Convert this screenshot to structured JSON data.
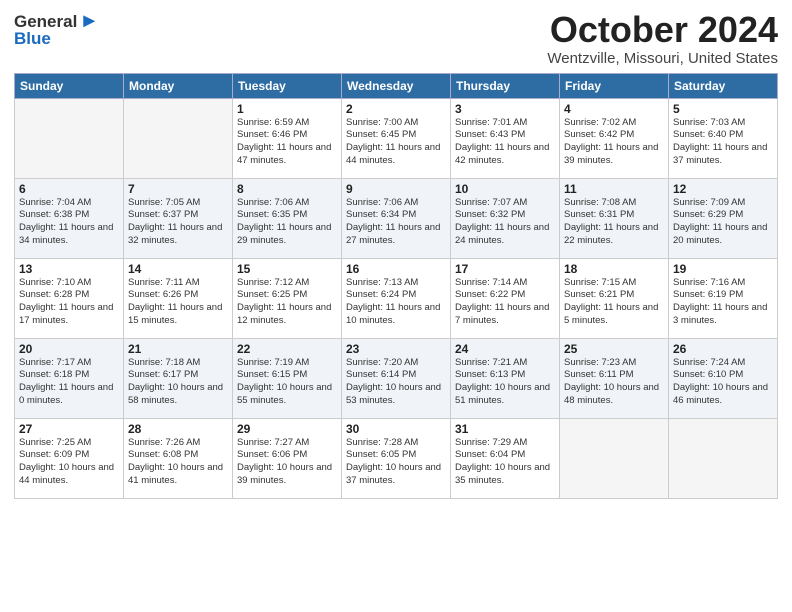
{
  "logo": {
    "general": "General",
    "blue": "Blue"
  },
  "title": {
    "month": "October 2024",
    "location": "Wentzville, Missouri, United States"
  },
  "headers": [
    "Sunday",
    "Monday",
    "Tuesday",
    "Wednesday",
    "Thursday",
    "Friday",
    "Saturday"
  ],
  "weeks": [
    [
      {
        "day": "",
        "info": ""
      },
      {
        "day": "",
        "info": ""
      },
      {
        "day": "1",
        "info": "Sunrise: 6:59 AM\nSunset: 6:46 PM\nDaylight: 11 hours and 47 minutes."
      },
      {
        "day": "2",
        "info": "Sunrise: 7:00 AM\nSunset: 6:45 PM\nDaylight: 11 hours and 44 minutes."
      },
      {
        "day": "3",
        "info": "Sunrise: 7:01 AM\nSunset: 6:43 PM\nDaylight: 11 hours and 42 minutes."
      },
      {
        "day": "4",
        "info": "Sunrise: 7:02 AM\nSunset: 6:42 PM\nDaylight: 11 hours and 39 minutes."
      },
      {
        "day": "5",
        "info": "Sunrise: 7:03 AM\nSunset: 6:40 PM\nDaylight: 11 hours and 37 minutes."
      }
    ],
    [
      {
        "day": "6",
        "info": "Sunrise: 7:04 AM\nSunset: 6:38 PM\nDaylight: 11 hours and 34 minutes."
      },
      {
        "day": "7",
        "info": "Sunrise: 7:05 AM\nSunset: 6:37 PM\nDaylight: 11 hours and 32 minutes."
      },
      {
        "day": "8",
        "info": "Sunrise: 7:06 AM\nSunset: 6:35 PM\nDaylight: 11 hours and 29 minutes."
      },
      {
        "day": "9",
        "info": "Sunrise: 7:06 AM\nSunset: 6:34 PM\nDaylight: 11 hours and 27 minutes."
      },
      {
        "day": "10",
        "info": "Sunrise: 7:07 AM\nSunset: 6:32 PM\nDaylight: 11 hours and 24 minutes."
      },
      {
        "day": "11",
        "info": "Sunrise: 7:08 AM\nSunset: 6:31 PM\nDaylight: 11 hours and 22 minutes."
      },
      {
        "day": "12",
        "info": "Sunrise: 7:09 AM\nSunset: 6:29 PM\nDaylight: 11 hours and 20 minutes."
      }
    ],
    [
      {
        "day": "13",
        "info": "Sunrise: 7:10 AM\nSunset: 6:28 PM\nDaylight: 11 hours and 17 minutes."
      },
      {
        "day": "14",
        "info": "Sunrise: 7:11 AM\nSunset: 6:26 PM\nDaylight: 11 hours and 15 minutes."
      },
      {
        "day": "15",
        "info": "Sunrise: 7:12 AM\nSunset: 6:25 PM\nDaylight: 11 hours and 12 minutes."
      },
      {
        "day": "16",
        "info": "Sunrise: 7:13 AM\nSunset: 6:24 PM\nDaylight: 11 hours and 10 minutes."
      },
      {
        "day": "17",
        "info": "Sunrise: 7:14 AM\nSunset: 6:22 PM\nDaylight: 11 hours and 7 minutes."
      },
      {
        "day": "18",
        "info": "Sunrise: 7:15 AM\nSunset: 6:21 PM\nDaylight: 11 hours and 5 minutes."
      },
      {
        "day": "19",
        "info": "Sunrise: 7:16 AM\nSunset: 6:19 PM\nDaylight: 11 hours and 3 minutes."
      }
    ],
    [
      {
        "day": "20",
        "info": "Sunrise: 7:17 AM\nSunset: 6:18 PM\nDaylight: 11 hours and 0 minutes."
      },
      {
        "day": "21",
        "info": "Sunrise: 7:18 AM\nSunset: 6:17 PM\nDaylight: 10 hours and 58 minutes."
      },
      {
        "day": "22",
        "info": "Sunrise: 7:19 AM\nSunset: 6:15 PM\nDaylight: 10 hours and 55 minutes."
      },
      {
        "day": "23",
        "info": "Sunrise: 7:20 AM\nSunset: 6:14 PM\nDaylight: 10 hours and 53 minutes."
      },
      {
        "day": "24",
        "info": "Sunrise: 7:21 AM\nSunset: 6:13 PM\nDaylight: 10 hours and 51 minutes."
      },
      {
        "day": "25",
        "info": "Sunrise: 7:23 AM\nSunset: 6:11 PM\nDaylight: 10 hours and 48 minutes."
      },
      {
        "day": "26",
        "info": "Sunrise: 7:24 AM\nSunset: 6:10 PM\nDaylight: 10 hours and 46 minutes."
      }
    ],
    [
      {
        "day": "27",
        "info": "Sunrise: 7:25 AM\nSunset: 6:09 PM\nDaylight: 10 hours and 44 minutes."
      },
      {
        "day": "28",
        "info": "Sunrise: 7:26 AM\nSunset: 6:08 PM\nDaylight: 10 hours and 41 minutes."
      },
      {
        "day": "29",
        "info": "Sunrise: 7:27 AM\nSunset: 6:06 PM\nDaylight: 10 hours and 39 minutes."
      },
      {
        "day": "30",
        "info": "Sunrise: 7:28 AM\nSunset: 6:05 PM\nDaylight: 10 hours and 37 minutes."
      },
      {
        "day": "31",
        "info": "Sunrise: 7:29 AM\nSunset: 6:04 PM\nDaylight: 10 hours and 35 minutes."
      },
      {
        "day": "",
        "info": ""
      },
      {
        "day": "",
        "info": ""
      }
    ]
  ]
}
